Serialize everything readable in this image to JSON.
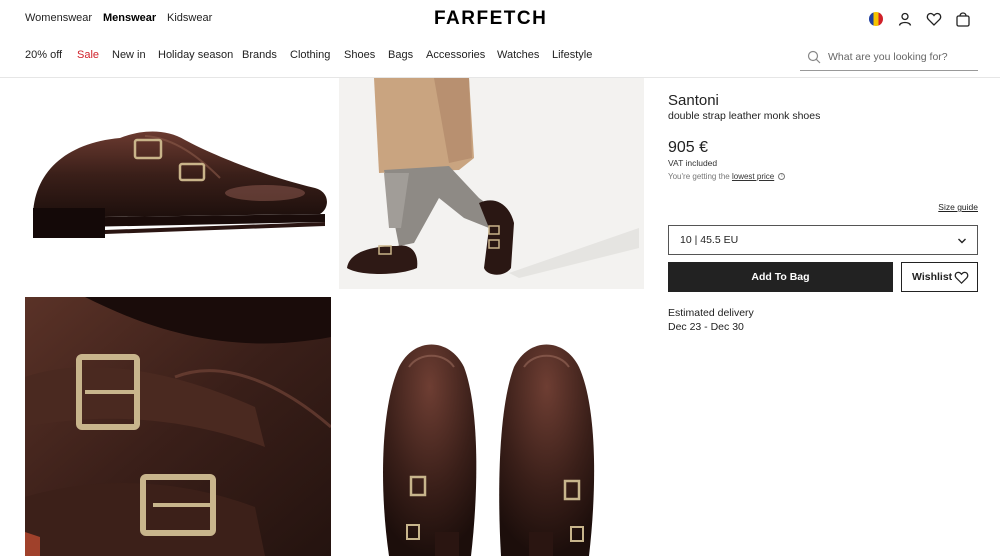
{
  "header": {
    "genders": [
      "Womenswear",
      "Menswear",
      "Kidswear"
    ],
    "active_gender": "Menswear",
    "logo": "FARFETCH",
    "icons": [
      "country-flag-icon",
      "account-icon",
      "wishlist-heart-icon",
      "shopping-bag-icon"
    ]
  },
  "nav": {
    "items": [
      "20% off",
      "Sale",
      "New in",
      "Holiday season",
      "Brands",
      "Clothing",
      "Shoes",
      "Bags",
      "Accessories",
      "Watches",
      "Lifestyle"
    ],
    "search_placeholder": "What are you looking for?"
  },
  "gallery": {
    "images": [
      "shoe-side-view-image",
      "model-wearing-shoes-image",
      "buckle-closeup-image",
      "shoes-top-view-image"
    ]
  },
  "product": {
    "brand": "Santoni",
    "name": "double strap leather monk shoes",
    "price": "905 €",
    "vat": "VAT included",
    "lowest_prefix": "You're getting the",
    "lowest_link": "lowest price",
    "size_guide": "Size guide",
    "selected_size": "10 | 45.5 EU",
    "add_to_bag": "Add To Bag",
    "wishlist": "Wishlist",
    "delivery_label": "Estimated delivery",
    "delivery_dates": "Dec 23 - Dec 30"
  },
  "colors": {
    "sale": "#d0212a",
    "leather": "#3a1f19",
    "button_dark": "#222222"
  }
}
